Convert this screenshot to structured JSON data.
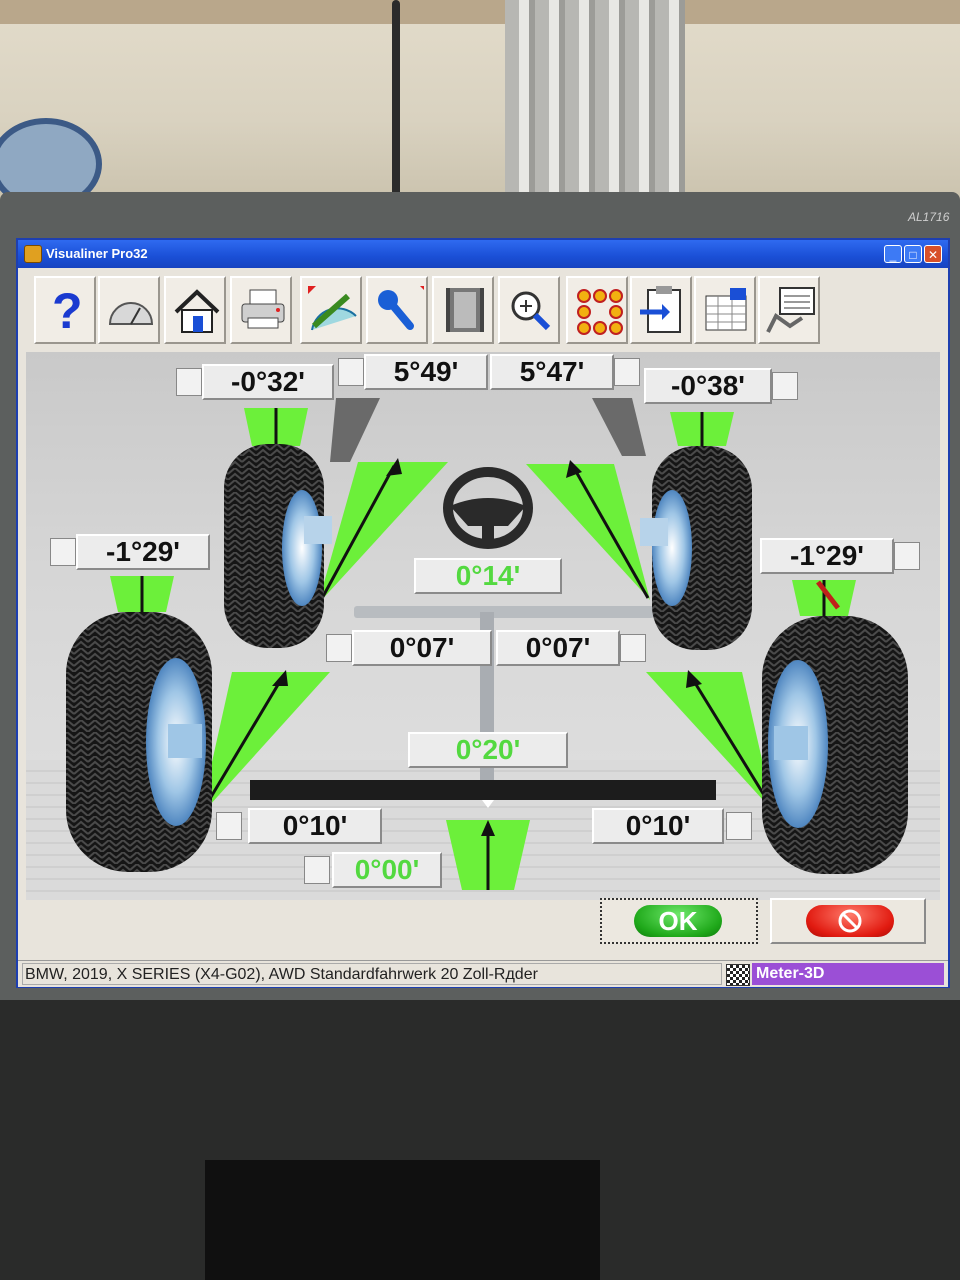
{
  "monitor": {
    "model_label": "AL1716"
  },
  "window": {
    "title": "Visualiner Pro32",
    "min_glyph": "_",
    "max_glyph": "□",
    "close_glyph": "✕"
  },
  "toolbar": {
    "buttons": [
      {
        "name": "help",
        "icon": "question-icon"
      },
      {
        "name": "gauge",
        "icon": "gauge-icon"
      },
      {
        "name": "home",
        "icon": "home-icon"
      },
      {
        "name": "print",
        "icon": "printer-icon"
      },
      {
        "name": "measure",
        "icon": "protractor-icon"
      },
      {
        "name": "adjust",
        "icon": "wrench-icon"
      },
      {
        "name": "film",
        "icon": "film-icon"
      },
      {
        "name": "zoom",
        "icon": "magnifier-icon"
      },
      {
        "name": "targets",
        "icon": "targets-icon"
      },
      {
        "name": "report",
        "icon": "clipboard-icon"
      },
      {
        "name": "spreadsheet",
        "icon": "spreadsheet-icon"
      },
      {
        "name": "vehicle-specs",
        "icon": "vehicle-screen-icon"
      }
    ]
  },
  "readings": {
    "front_left_camber": "-0°32'",
    "front_left_caster": "5°49'",
    "front_right_caster": "5°47'",
    "front_right_camber": "-0°38'",
    "rear_left_camber": "-1°29'",
    "rear_right_camber": "-1°29'",
    "steering_center": "0°14'",
    "front_left_toe": "0°07'",
    "front_right_toe": "0°07'",
    "front_total_toe": "0°20'",
    "rear_left_toe": "0°10'",
    "rear_right_toe": "0°10'",
    "thrust_angle": "0°00'"
  },
  "buttons": {
    "ok_label": "OK"
  },
  "status": {
    "vehicle": "BMW, 2019, X SERIES (X4-G02), AWD Standardfahrwerk 20 Zoll-Rдder",
    "device": "Meter-3D"
  },
  "colors": {
    "indicator_green": "#6cf03a",
    "value_green": "#53d940",
    "status_purple": "#9b4fd6",
    "title_blue": "#1a4fd6"
  }
}
